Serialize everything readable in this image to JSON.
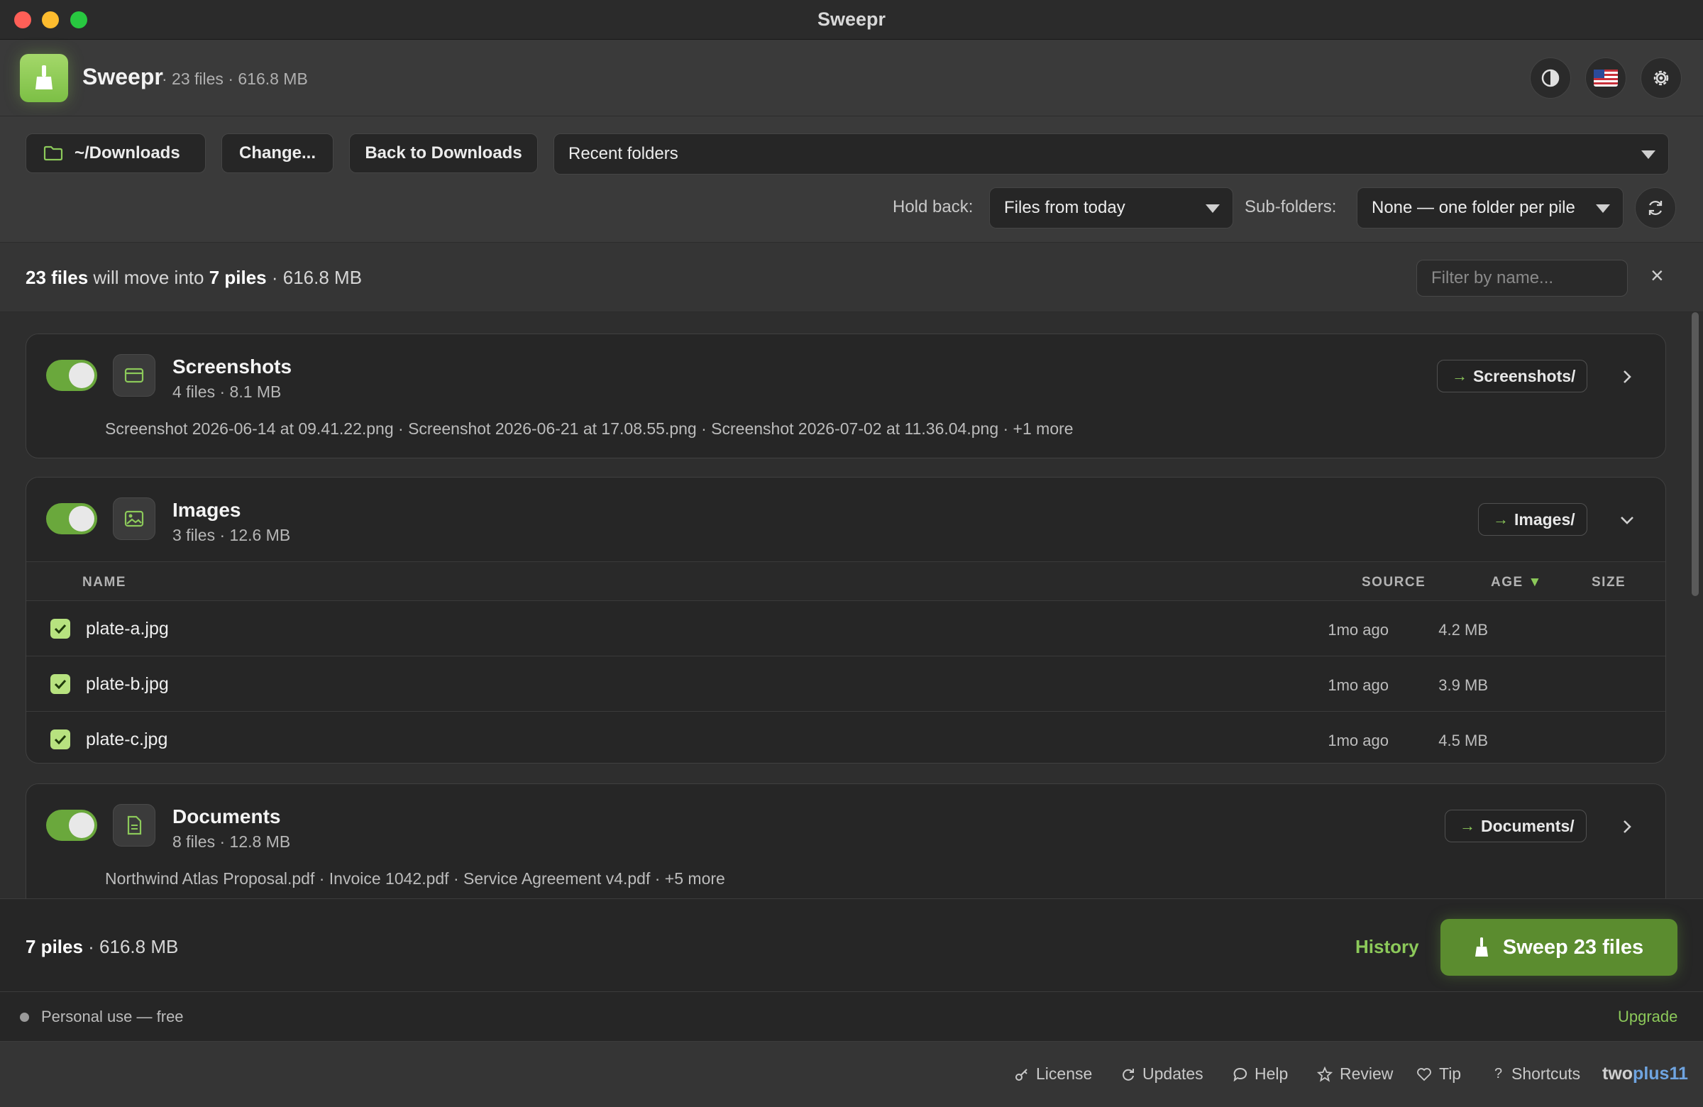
{
  "window": {
    "title": "Sweepr"
  },
  "header": {
    "app_name": "Sweepr",
    "stats": "· 23 files · 616.8 MB",
    "buttons": [
      "contrast-icon",
      "us-flag-icon",
      "gear-icon"
    ]
  },
  "toolbar": {
    "folder": "~/Downloads",
    "change_label": "Change...",
    "back_label": "Back to Downloads",
    "recent_folders": "Recent folders",
    "hold_back_label": "Hold back:",
    "hold_back_value": "Files from today",
    "subfolders_label": "Sub-folders:",
    "subfolders_value": "None — one folder per pile"
  },
  "summary": {
    "files": "23 files",
    "mid": "will move into",
    "piles": "7 piles",
    "size": "· 616.8 MB",
    "filter_placeholder": "Filter by name...",
    "clear": "×"
  },
  "piles": [
    {
      "name": "Screenshots",
      "stats": "4 files · 8.1 MB",
      "dest": "Screenshots/",
      "enabled": true,
      "preview": "Screenshot 2026-06-14 at 09.41.22.png · Screenshot 2026-06-21 at 17.08.55.png · Screenshot 2026-07-02 at 11.36.04.png · +1 more"
    },
    {
      "name": "Images",
      "stats": "3 files · 12.6 MB",
      "dest": "Images/",
      "enabled": true,
      "columns": {
        "name": "NAME",
        "source": "SOURCE",
        "age": "AGE",
        "size": "SIZE",
        "sort_arrow": "▼"
      },
      "files": [
        {
          "name": "plate-a.jpg",
          "age": "1mo ago",
          "size": "4.2 MB",
          "checked": true
        },
        {
          "name": "plate-b.jpg",
          "age": "1mo ago",
          "size": "3.9 MB",
          "checked": true
        },
        {
          "name": "plate-c.jpg",
          "age": "1mo ago",
          "size": "4.5 MB",
          "checked": true
        }
      ]
    },
    {
      "name": "Documents",
      "stats": "8 files · 12.8 MB",
      "dest": "Documents/",
      "enabled": true,
      "preview": "Northwind Atlas Proposal.pdf · Invoice 1042.pdf · Service Agreement v4.pdf · +5 more"
    }
  ],
  "action": {
    "piles": "7 piles",
    "size": "· 616.8 MB",
    "history_label": "History",
    "sweep_label": "Sweep 23 files"
  },
  "license": {
    "text": "Personal use — free",
    "upgrade_label": "Upgrade"
  },
  "footer": {
    "links": [
      "License",
      "Updates",
      "Help",
      "Review",
      "Tip",
      "Shortcuts"
    ],
    "brand_a": "two",
    "brand_b": "plus11"
  },
  "colors": {
    "accent": "#8cc95a",
    "toggle_on": "#6aa83c",
    "sweep_button": "#5b8c2f"
  }
}
